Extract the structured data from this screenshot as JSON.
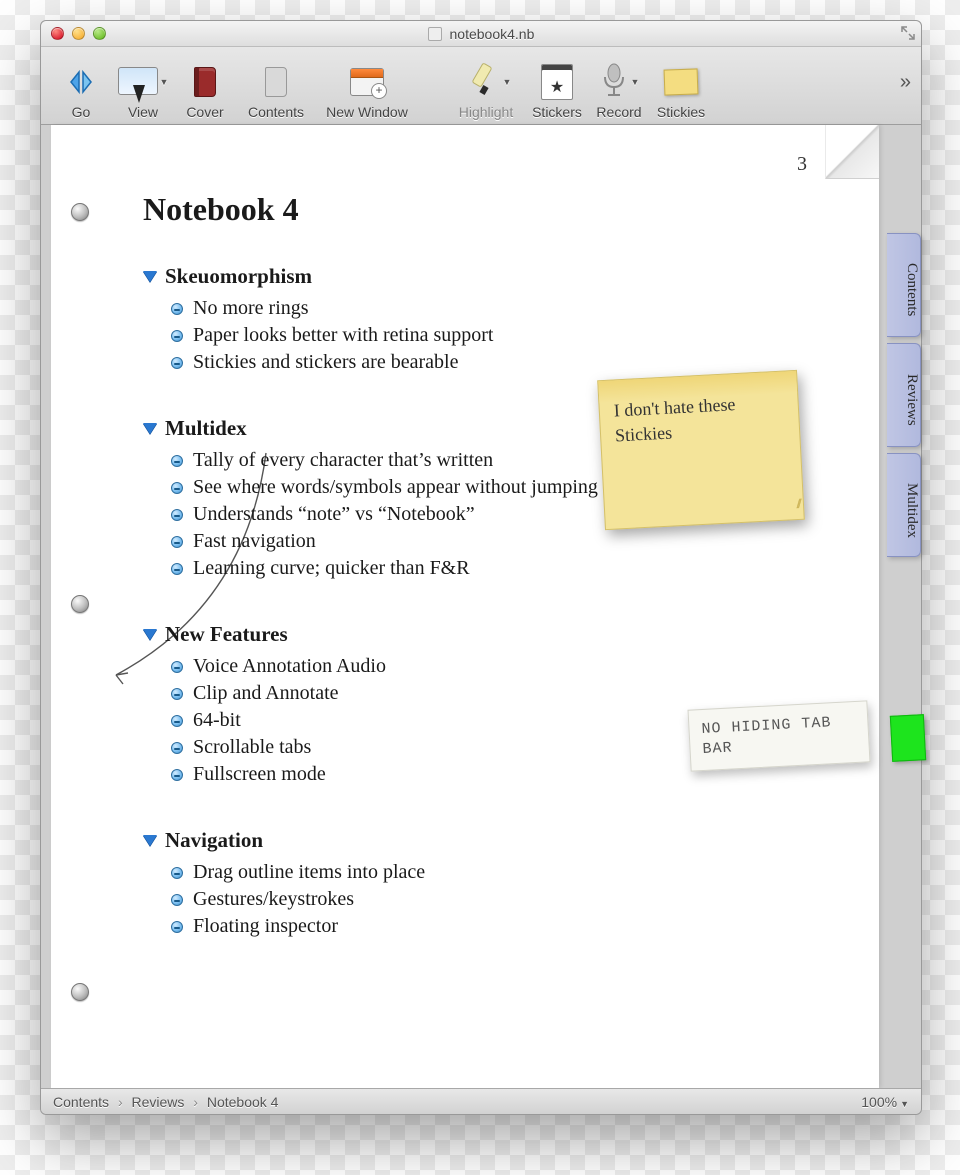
{
  "window": {
    "title": "notebook4.nb"
  },
  "toolbar": {
    "go": "Go",
    "view": "View",
    "cover": "Cover",
    "contents": "Contents",
    "newWindow": "New Window",
    "highlight": "Highlight",
    "stickers": "Stickers",
    "record": "Record",
    "stickies": "Stickies"
  },
  "sideTabs": [
    "Contents",
    "Reviews",
    "Multidex"
  ],
  "page": {
    "number": "3",
    "title": "Notebook 4",
    "sections": [
      {
        "heading": "Skeuomorphism",
        "items": [
          "No more rings",
          "Paper looks better with retina support",
          "Stickies and stickers are bearable"
        ]
      },
      {
        "heading": "Multidex",
        "items": [
          "Tally of every character that’s written",
          "See where words/symbols appear without jumping around",
          "Understands “note” vs “Notebook”",
          "Fast navigation",
          "Learning curve; quicker than F&R"
        ]
      },
      {
        "heading": "New Features",
        "items": [
          "Voice Annotation Audio",
          "Clip and Annotate",
          "64-bit",
          "Scrollable tabs",
          "Fullscreen mode"
        ]
      },
      {
        "heading": "Navigation",
        "items": [
          "Drag outline items into place",
          "Gestures/keystrokes",
          "Floating inspector"
        ]
      }
    ]
  },
  "stickies": {
    "yellow": "I don't hate these Stickies",
    "white": "NO HIDING TAB BAR"
  },
  "breadcrumb": [
    "Contents",
    "Reviews",
    "Notebook 4"
  ],
  "zoom": "100%"
}
